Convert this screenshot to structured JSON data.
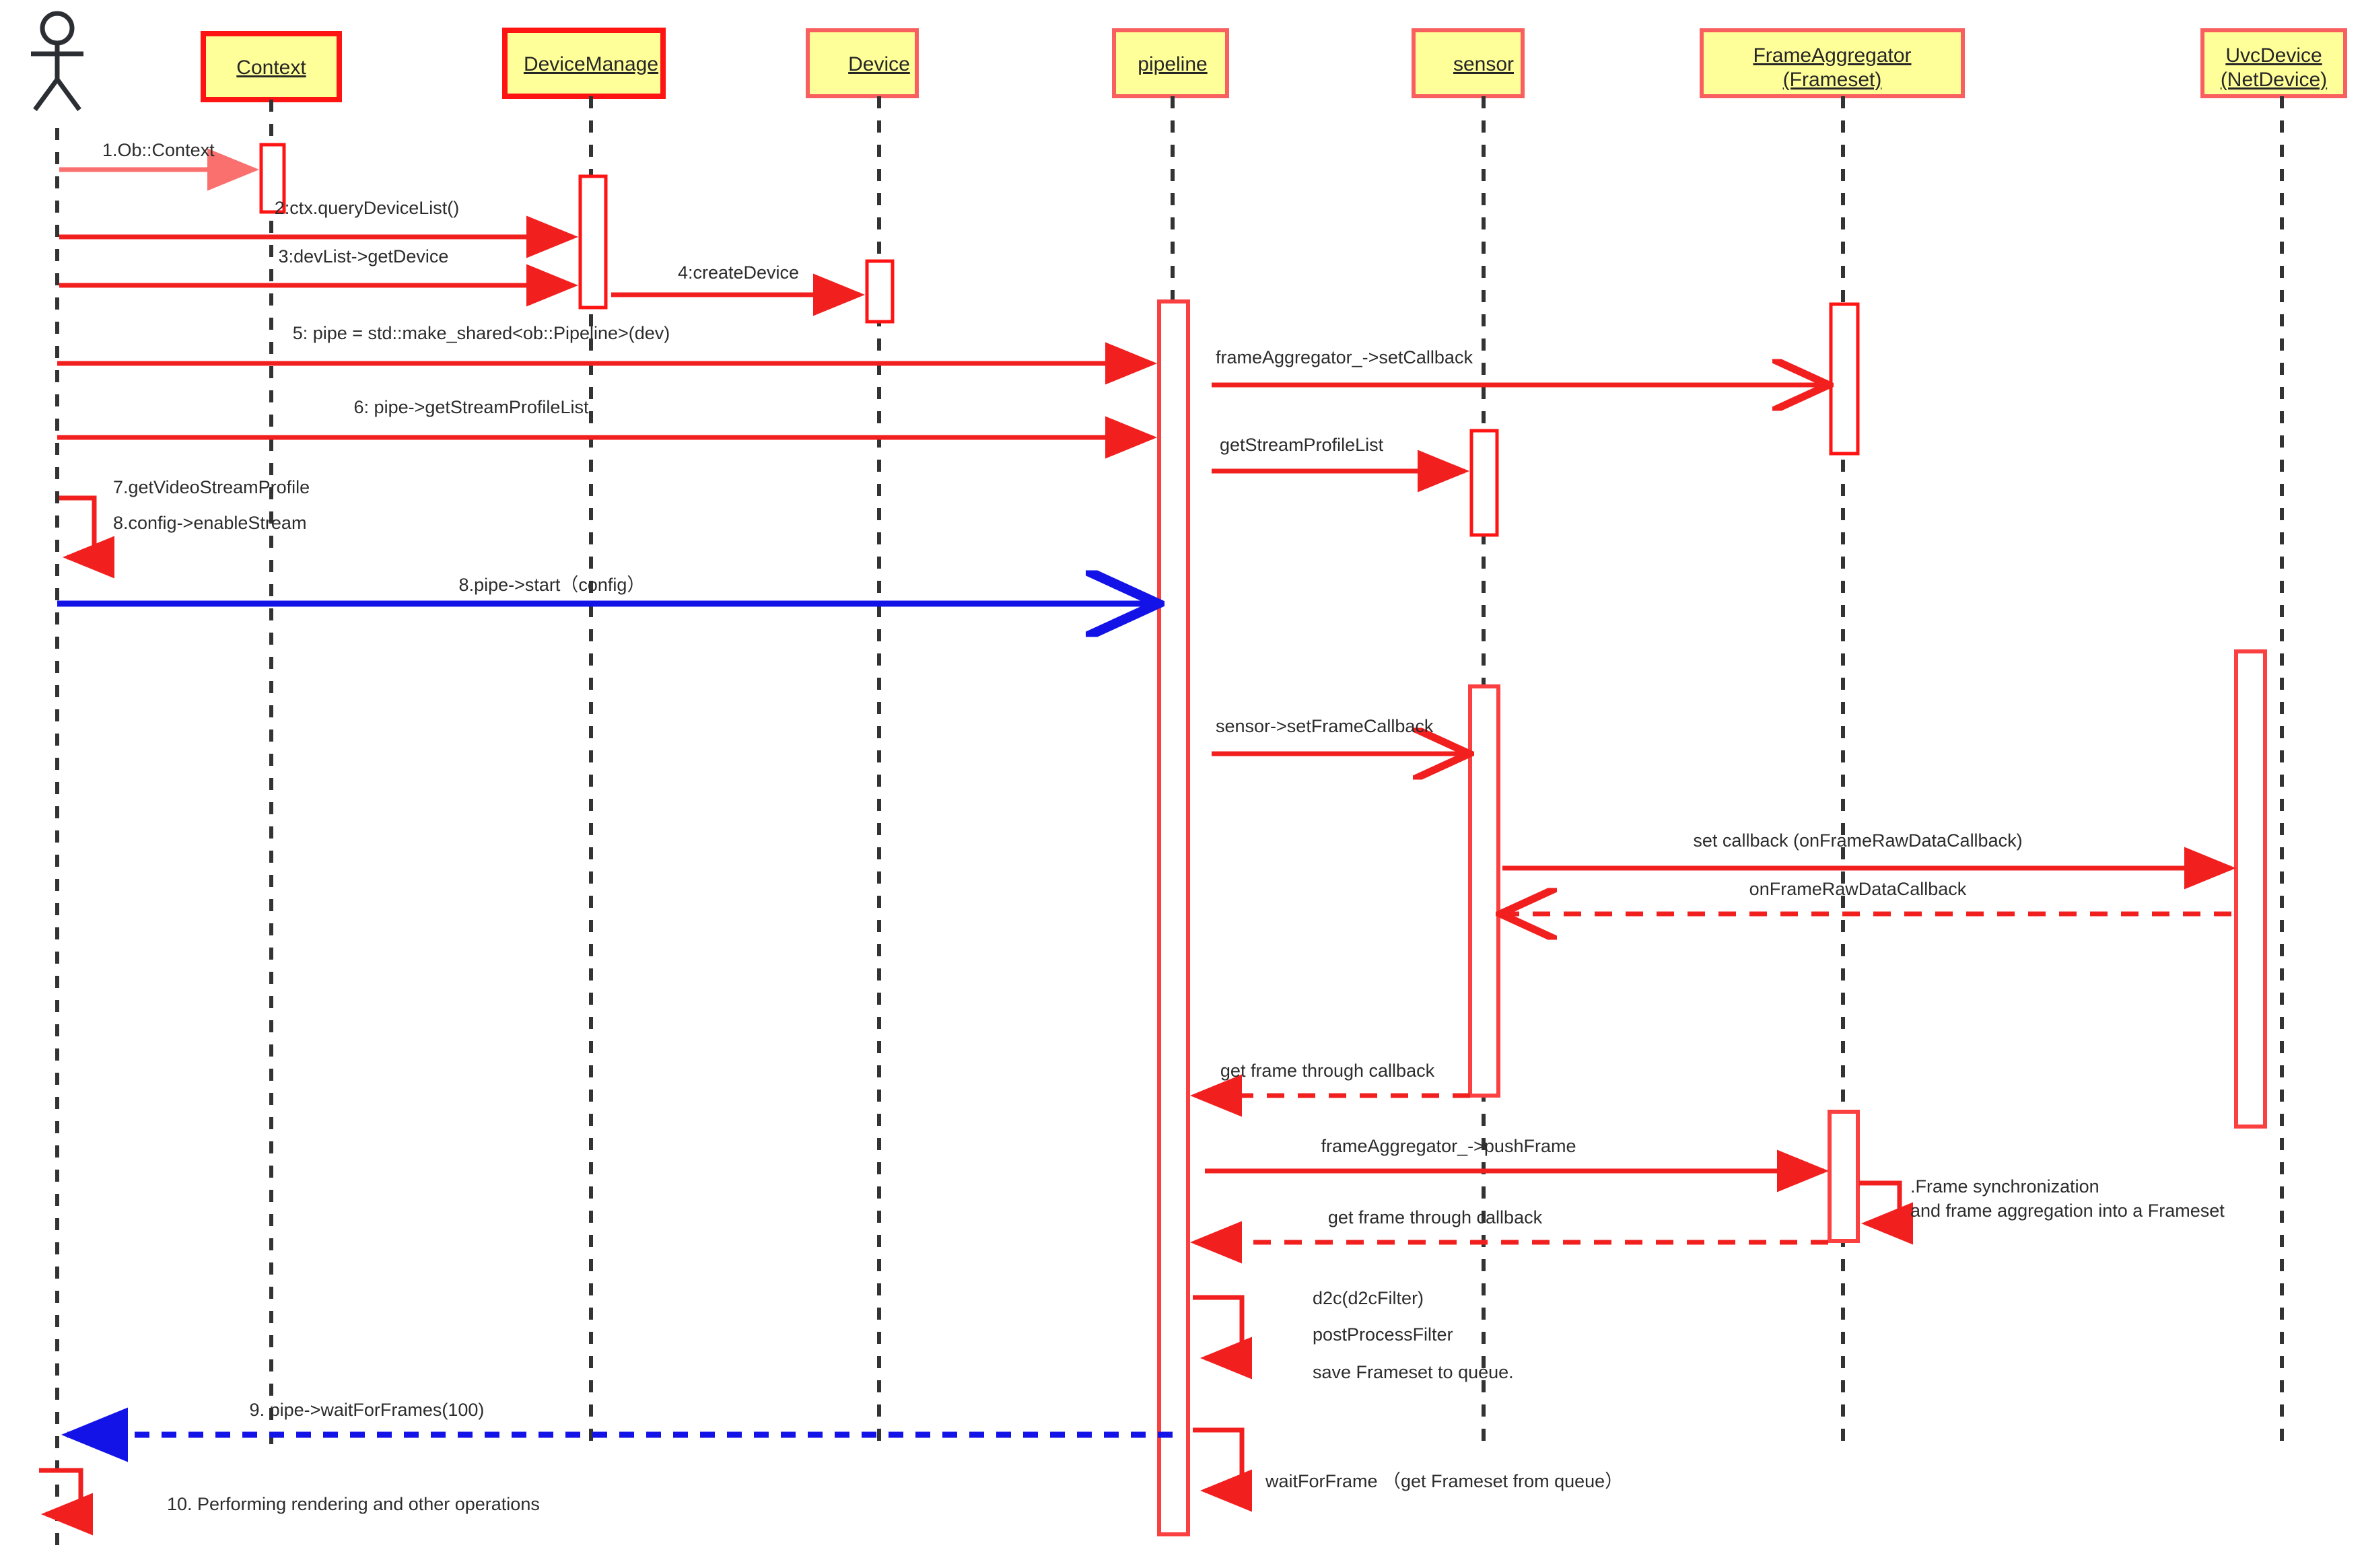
{
  "diagram": {
    "title": "Pipeline frame acquisition sequence diagram",
    "type": "uml-sequence-diagram",
    "colors": {
      "lifeline_fill": "#ffff99",
      "lifeline_border": "#fa5f5f",
      "lifeline_border_strong": "#ff1414",
      "message_red": "#f21f1f",
      "message_pale_red": "#f9706f",
      "message_blue": "#1313e8",
      "text": "#2c2c2c",
      "background": "#ffffff"
    }
  },
  "actor": {
    "name": "user-actor",
    "label": ""
  },
  "participants": [
    {
      "id": "context",
      "label": "Context",
      "sublabel": ""
    },
    {
      "id": "device_manage",
      "label": "DeviceManage",
      "sublabel": ""
    },
    {
      "id": "device",
      "label": "Device",
      "sublabel": ""
    },
    {
      "id": "pipeline",
      "label": "pipeline",
      "sublabel": ""
    },
    {
      "id": "sensor",
      "label": "sensor",
      "sublabel": ""
    },
    {
      "id": "frame_aggregator",
      "label": "FrameAggregator",
      "sublabel": "(Frameset)"
    },
    {
      "id": "uvc_device",
      "label": "UvcDevice",
      "sublabel": " (NetDevice) "
    }
  ],
  "messages": [
    {
      "id": "m1",
      "label": "1.Ob::Context",
      "from": "actor",
      "to": "context",
      "style": "solid-pale"
    },
    {
      "id": "m2",
      "label": "2:ctx.queryDeviceList()",
      "from": "actor",
      "to": "device_manage",
      "style": "solid"
    },
    {
      "id": "m3",
      "label": "3:devList->getDevice",
      "from": "actor",
      "to": "device_manage",
      "style": "solid"
    },
    {
      "id": "m4",
      "label": "4:createDevice",
      "from": "device_manage",
      "to": "device",
      "style": "solid"
    },
    {
      "id": "m5",
      "label": "5: pipe = std::make_shared<ob::Pipeline>(dev)",
      "from": "actor",
      "to": "pipeline",
      "style": "solid"
    },
    {
      "id": "m6",
      "label": "frameAggregator_->setCallback",
      "from": "pipeline",
      "to": "frame_aggregator",
      "style": "solid"
    },
    {
      "id": "m7",
      "label": "6: pipe->getStreamProfileList",
      "from": "actor",
      "to": "pipeline",
      "style": "solid"
    },
    {
      "id": "m8",
      "label": "getStreamProfileList",
      "from": "pipeline",
      "to": "sensor",
      "style": "solid"
    },
    {
      "id": "m9",
      "label": "7.getVideoStreamProfile",
      "from": "actor",
      "to": "actor",
      "style": "self"
    },
    {
      "id": "m10",
      "label": "8.config->enableStream",
      "from": "actor",
      "to": "actor",
      "style": "self-return"
    },
    {
      "id": "m11",
      "label": "8.pipe->start（config）",
      "from": "actor",
      "to": "pipeline",
      "style": "solid-blue"
    },
    {
      "id": "m12",
      "label": "sensor->setFrameCallback",
      "from": "pipeline",
      "to": "sensor",
      "style": "solid"
    },
    {
      "id": "m13",
      "label": "set callback (onFrameRawDataCallback)",
      "from": "sensor",
      "to": "uvc_device",
      "style": "solid"
    },
    {
      "id": "m14",
      "label": "onFrameRawDataCallback",
      "from": "uvc_device",
      "to": "sensor",
      "style": "dashed"
    },
    {
      "id": "m15",
      "label": "get frame through callback",
      "from": "sensor",
      "to": "pipeline",
      "style": "dashed"
    },
    {
      "id": "m16",
      "label": "frameAggregator_->pushFrame",
      "from": "pipeline",
      "to": "frame_aggregator",
      "style": "solid"
    },
    {
      "id": "m17",
      "label": "get frame through callback",
      "from": "frame_aggregator",
      "to": "pipeline",
      "style": "dashed"
    },
    {
      "id": "m18",
      "label": "9. pipe->waitForFrames(100)",
      "from": "pipeline",
      "to": "actor",
      "style": "dashed-blue"
    },
    {
      "id": "m19",
      "label": "10. Performing rendering and other operations",
      "from": "actor",
      "to": "actor",
      "style": "self"
    }
  ],
  "self_notes": [
    {
      "id": "n1",
      "owner": "frame_aggregator",
      "lines": [
        ".Frame synchronization",
        "and frame aggregation into a Frameset"
      ]
    },
    {
      "id": "n2",
      "owner": "pipeline",
      "lines": [
        "d2c(d2cFilter)",
        "postProcessFilter",
        "save Frameset to queue."
      ]
    },
    {
      "id": "n3",
      "owner": "pipeline",
      "lines": [
        "waitForFrame （get Frameset from  queue）"
      ]
    }
  ]
}
